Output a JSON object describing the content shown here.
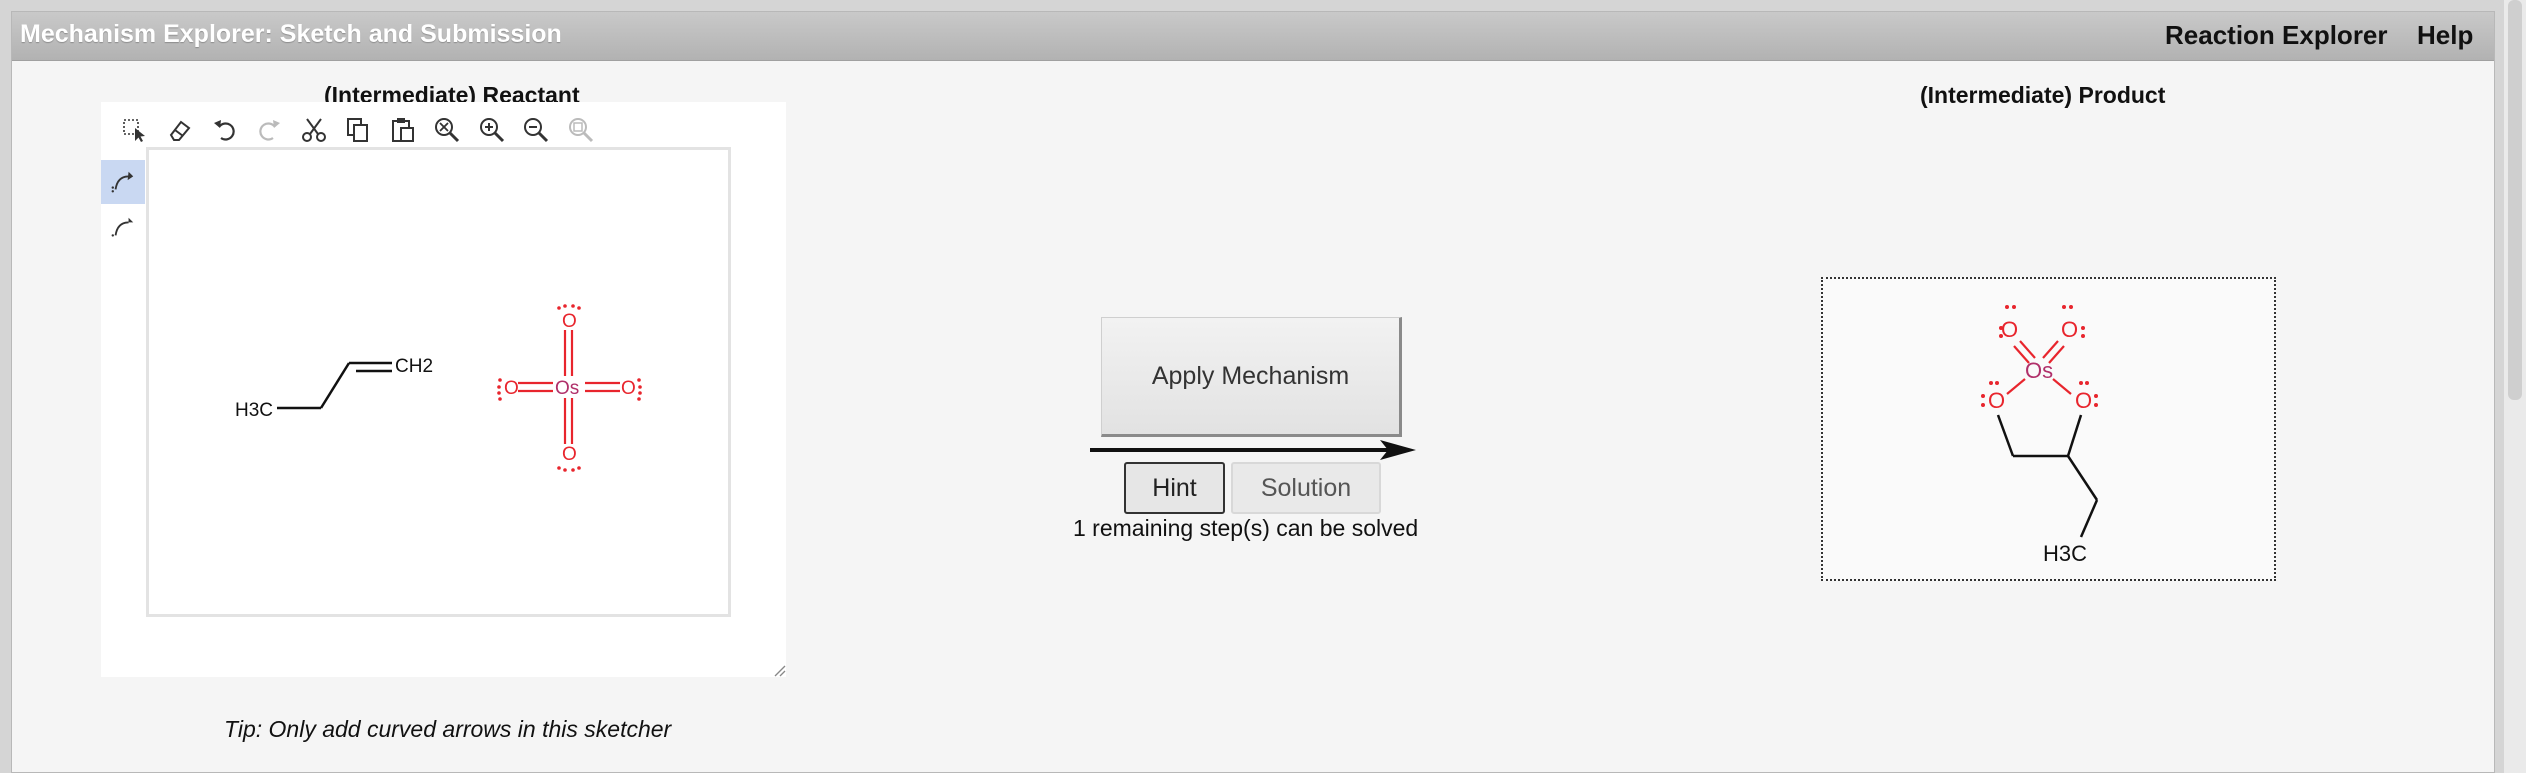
{
  "window": {
    "title": "Mechanism Explorer: Sketch and Submission",
    "menu": [
      {
        "label": "Reaction Explorer"
      },
      {
        "label": "Help"
      }
    ]
  },
  "reactant_panel": {
    "title": "(Intermediate) Reactant",
    "toolbar": [
      {
        "icon": "select-icon"
      },
      {
        "icon": "eraser-icon"
      },
      {
        "icon": "undo-icon"
      },
      {
        "icon": "redo-icon"
      },
      {
        "icon": "cut-icon"
      },
      {
        "icon": "copy-icon"
      },
      {
        "icon": "paste-icon"
      },
      {
        "icon": "zoom-reset-icon"
      },
      {
        "icon": "zoom-in-icon"
      },
      {
        "icon": "zoom-out-icon"
      },
      {
        "icon": "zoom-fit-icon"
      }
    ],
    "side_tools": [
      {
        "icon": "curved-arrow-electron-pair-icon",
        "active": true
      },
      {
        "icon": "curved-arrow-single-electron-icon",
        "active": false
      }
    ],
    "molecules": {
      "alkene": {
        "left_label": "H3C",
        "right_label": "CH2"
      },
      "osmium": {
        "center": "Os",
        "ligand": "O"
      }
    },
    "tip": "Tip: Only add curved arrows in this sketcher"
  },
  "actions": {
    "apply_label": "Apply Mechanism",
    "hint_label": "Hint",
    "solution_label": "Solution",
    "status": "1 remaining step(s) can be solved"
  },
  "product_panel": {
    "title": "(Intermediate) Product",
    "molecule": {
      "metal": "Os",
      "oxygen": "O",
      "methyl": "H3C"
    }
  },
  "colors": {
    "oxygen": "#e8252d",
    "osmium": "#b0306a",
    "bond": "#111111",
    "active_tool": "#c9d8f2"
  }
}
